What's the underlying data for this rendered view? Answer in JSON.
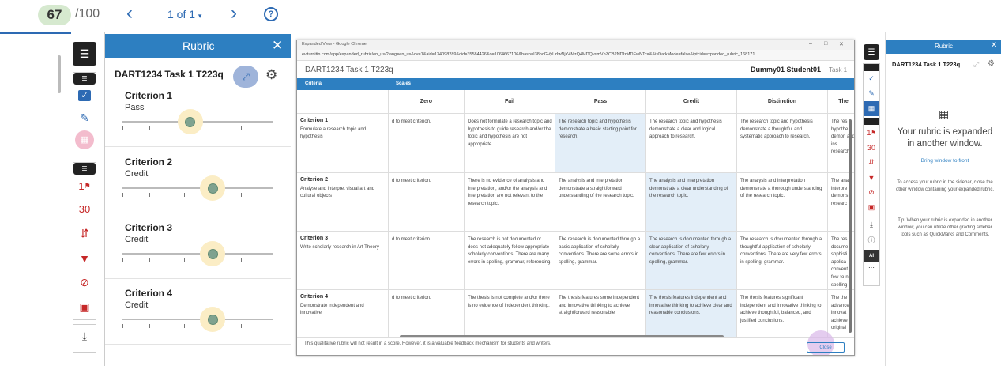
{
  "topbar": {
    "grade_value": "67",
    "grade_max": "/100",
    "page_indicator": "1 of 1"
  },
  "rubric": {
    "header_title": "Rubric",
    "rubric_name": "DART1234 Task 1 T223q",
    "criteria": [
      {
        "name": "Criterion 1",
        "level": "Pass",
        "score_fraction": 0.45
      },
      {
        "name": "Criterion 2",
        "level": "Credit",
        "score_fraction": 0.6
      },
      {
        "name": "Criterion 3",
        "level": "Credit",
        "score_fraction": 0.6
      },
      {
        "name": "Criterion 4",
        "level": "Credit",
        "score_fraction": 0.6
      }
    ]
  },
  "tools": {
    "flag_count": "1",
    "number_30": "30",
    "ai_label": "AI"
  },
  "popup": {
    "window_title": "Expanded View - Google Chrome",
    "url": "ev.turnitin.com/app/expanded_rubric/en_us/?lang=en_us&cv=1&aid=134098289&cid=35584426&o=1064667106&hash=I38hcGVyLzIwNjY4MzQ4MDQvcmVhZCB2NDIzMDEwNTc=&&isDarkMode=false&iptcid=expanded_rubric_168171",
    "rubric_name": "DART1234 Task 1 T223q",
    "student_name": "Dummy01 Student01",
    "task_label": "Task 1",
    "criteria_label": "Criteria",
    "scales_label": "Scales",
    "scale_headers": [
      "Zero",
      "Fail",
      "Pass",
      "Credit",
      "Distinction",
      "The"
    ],
    "rows": [
      {
        "name": "Criterion 1",
        "desc": "Formulate a research topic and hypothesis",
        "cells": [
          "d to meet criterion.",
          "Does not formulate a research topic and hypothesis to guide research and/or the topic and hypothesis are not appropriate.",
          "The research topic and hypothesis demonstrate a basic starting point for research.",
          "The research topic and hypothesis demonstrate a clear and logical approach to research.",
          "The research topic and hypothesis demonstrate a thoughtful and systematic approach to research.",
          "The res hypothe demon and ins research"
        ]
      },
      {
        "name": "Criterion 2",
        "desc": "Analyse and interpret visual art and cultural objects",
        "cells": [
          "d to meet criterion.",
          "There is no evidence of analysis and interpretation, and/or the analysis and interpretation are not relevant to the research topic.",
          "The analysis and interpretation demonstrate a straightforward understanding of the research topic.",
          "The analysis and interpretation demonstrate a clear understanding of the research topic.",
          "The analysis and interpretation demonstrate a thorough understanding of the research topic.",
          "The ana interpre demons researc"
        ]
      },
      {
        "name": "Criterion 3",
        "desc": "Write scholarly research in Art Theory",
        "cells": [
          "d to meet criterion.",
          "The research is not documented or does not adequately follow appropriate scholarly conventions. There are many errors in spelling, grammar, referencing.",
          "The research is documented through a basic application of scholarly conventions. There are some errors in spelling, grammar.",
          "The research is documented through a clear application of scholarly conventions. There are few errors in spelling, grammar.",
          "The research is documented through a thoughtful application of scholarly conventions. There are very few errors in spelling, grammar.",
          "The res docume sophisti applica convent few-to-n spelling"
        ]
      },
      {
        "name": "Criterion 4",
        "desc": "Demonstrate independent and innovative",
        "cells": [
          "d to meet criterion.",
          "The thesis is not complete and/or there is no evidence of independent thinking.",
          "The thesis features some independent and innovative thinking to achieve straightforward reasonable",
          "The thesis features independent and innovative thinking to achieve clear and reasonable conclusions.",
          "The thesis features significant independent and innovative thinking to achieve thoughtful, balanced, and justified conclusions.",
          "The the advance innovat achieve original"
        ]
      }
    ],
    "footer_note": "This qualitative rubric will not result in a score. However, it is a valuable feedback mechanism for students and writers.",
    "close_label": "Close"
  },
  "right_panel": {
    "header_title": "Rubric",
    "rubric_name": "DART1234 Task 1 T223q",
    "expanded_title": "Your rubric is expanded in another window.",
    "bring_to_front": "Bring window to front",
    "access_note": "To access your rubric in the sidebar, close the other window containing your expanded rubric.",
    "tip_note": "Tip: When your rubric is expanded in another window, you can utilize other grading sidebar tools such as QuickMarks and Comments."
  },
  "colors": {
    "brand_blue": "#2d7fc1",
    "nav_blue": "#2d6ab3",
    "tool_red": "#c62828",
    "highlight_cell": "#e3eef8"
  }
}
